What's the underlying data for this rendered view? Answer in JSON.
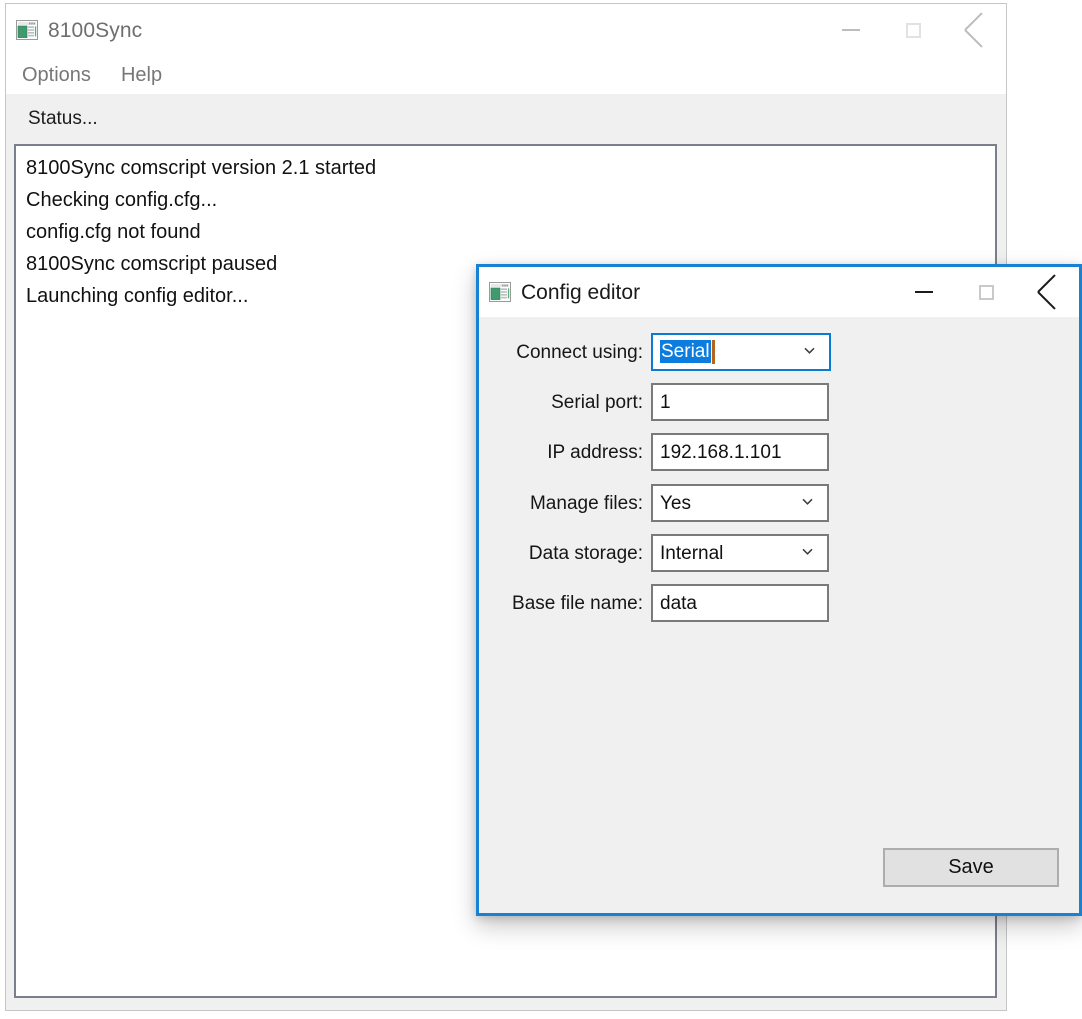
{
  "main_window": {
    "title": "8100Sync",
    "icon": "app-window-icon",
    "caption_buttons": [
      {
        "name": "minimize",
        "glyph": "minimize-icon"
      },
      {
        "name": "maximize",
        "glyph": "maximize-icon"
      },
      {
        "name": "close",
        "glyph": "close-icon"
      }
    ],
    "menu": [
      {
        "label": "Options"
      },
      {
        "label": "Help"
      }
    ],
    "status_label": "Status...",
    "log_lines": [
      "8100Sync comscript version 2.1 started",
      "Checking config.cfg...",
      "config.cfg not found",
      "8100Sync comscript paused",
      "Launching config editor..."
    ]
  },
  "dialog": {
    "title": "Config editor",
    "icon": "app-window-icon",
    "caption_buttons": [
      {
        "name": "minimize",
        "glyph": "minimize-icon"
      },
      {
        "name": "maximize",
        "glyph": "maximize-icon"
      },
      {
        "name": "close",
        "glyph": "close-icon"
      }
    ],
    "fields": [
      {
        "label": "Connect using:",
        "type": "combobox",
        "value": "Serial",
        "focused": true,
        "selected": true,
        "caret": true
      },
      {
        "label": "Serial port:",
        "type": "textbox",
        "value": "1",
        "focused": false,
        "selected": false,
        "caret": false
      },
      {
        "label": "IP address:",
        "type": "textbox",
        "value": "192.168.1.101",
        "focused": false,
        "selected": false,
        "caret": false
      },
      {
        "label": "Manage files:",
        "type": "combobox",
        "value": "Yes",
        "focused": false,
        "selected": false,
        "caret": false
      },
      {
        "label": "Data storage:",
        "type": "combobox",
        "value": "Internal",
        "focused": false,
        "selected": false,
        "caret": false
      },
      {
        "label": "Base file name:",
        "type": "textbox",
        "value": "data",
        "focused": false,
        "selected": false,
        "caret": false
      }
    ],
    "save_label": "Save"
  },
  "colors": {
    "accent_blue": "#1782d4",
    "selection_blue": "#0c7ddf",
    "client_gray": "#f0f0f0",
    "log_border": "#7b7f8c",
    "button_face": "#e1e1e1"
  }
}
